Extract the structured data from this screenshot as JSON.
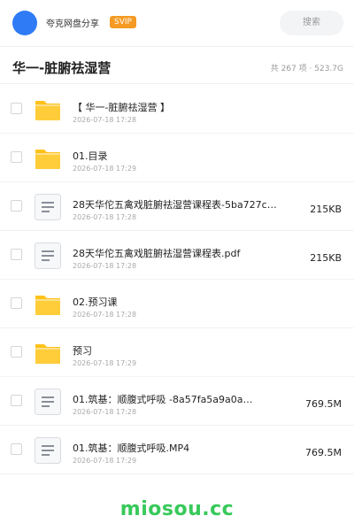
{
  "header": {
    "brand": "夸克网盘分享",
    "badge": "SVIP",
    "search_label": "搜索",
    "avatar_color": "#2f7bf6",
    "badge_color": "#f59a23"
  },
  "share": {
    "title": "华一-脏腑祛湿营",
    "meta": "共 267 项 · 523.7G"
  },
  "files": [
    {
      "icon": "folder-icon",
      "name": "【 华一-脏腑祛湿营 】",
      "date": "2026-07-18 17:28",
      "size": ""
    },
    {
      "icon": "folder-icon",
      "name": "01.目录",
      "date": "2026-07-18 17:29",
      "size": ""
    },
    {
      "icon": "document-icon",
      "name": "28天华佗五禽戏脏腑祛湿营课程表-5ba727ca…",
      "date": "2026-07-18 17:28",
      "size": "215KB"
    },
    {
      "icon": "document-icon",
      "name": "28天华佗五禽戏脏腑祛湿营课程表.pdf",
      "date": "2026-07-18 17:28",
      "size": "215KB"
    },
    {
      "icon": "folder-icon",
      "name": "02.预习课",
      "date": "2026-07-18 17:28",
      "size": ""
    },
    {
      "icon": "folder-icon",
      "name": "预习",
      "date": "2026-07-18 17:29",
      "size": ""
    },
    {
      "icon": "document-icon",
      "name": "01.筑基：顺腹式呼吸 -8a57fa5a9a0a…",
      "date": "2026-07-18 17:28",
      "size": "769.5M"
    },
    {
      "icon": "document-icon",
      "name": "01.筑基：顺腹式呼吸.MP4",
      "date": "2026-07-18 17:29",
      "size": "769.5M"
    }
  ],
  "footer": {
    "watermark": "miosou.cc",
    "watermark_color": "#37c95a"
  }
}
